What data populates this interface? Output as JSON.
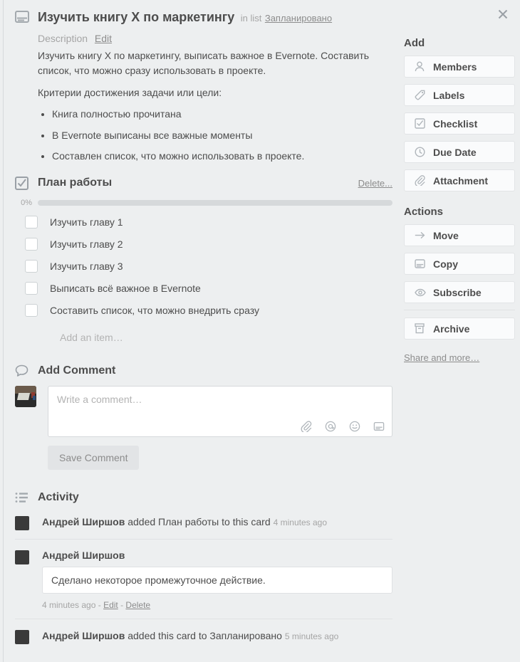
{
  "header": {
    "card_icon": "card-window-icon",
    "title": "Изучить книгу X по маркетингу",
    "in_list_label": "in list",
    "list_name": "Запланировано",
    "close_icon": "close-icon"
  },
  "description": {
    "heading": "Description",
    "edit_label": "Edit",
    "paragraph": "Изучить книгу X по маркетингу, выписать важное в Evernote. Составить список, что можно сразу использовать в проекте.",
    "criteria_intro": "Критерии достижения задачи или цели:",
    "criteria": [
      "Книга полностью прочитана",
      "В Evernote выписаны все важные моменты",
      "Составлен список, что можно использовать в проекте."
    ]
  },
  "checklist": {
    "icon": "checklist-icon",
    "title": "План работы",
    "delete_label": "Delete...",
    "progress_percent": "0%",
    "progress_value": 0,
    "items": [
      {
        "label": "Изучить главу 1",
        "checked": false
      },
      {
        "label": "Изучить главу 2",
        "checked": false
      },
      {
        "label": "Изучить главу 3",
        "checked": false
      },
      {
        "label": "Выписать всё важное в Evernote",
        "checked": false
      },
      {
        "label": "Составить список, что можно внедрить сразу",
        "checked": false
      }
    ],
    "add_item_placeholder": "Add an item…"
  },
  "comment": {
    "icon": "comment-bubble-icon",
    "heading": "Add Comment",
    "placeholder": "Write a comment…",
    "value": "",
    "tools": [
      "attachment-icon",
      "mention-icon",
      "emoji-icon",
      "card-icon"
    ],
    "save_label": "Save Comment"
  },
  "activity": {
    "icon": "activity-list-icon",
    "heading": "Activity",
    "entries": [
      {
        "type": "action",
        "author": "Андрей Ширшов",
        "action_text": "added План работы to this card",
        "time": "4 minutes ago"
      },
      {
        "type": "comment",
        "author": "Андрей Ширшов",
        "text": "Сделано некоторое промежуточное действие.",
        "time": "4 minutes ago",
        "edit_label": "Edit",
        "delete_label": "Delete",
        "separator": "-"
      },
      {
        "type": "action",
        "author": "Андрей Ширшов",
        "action_text": "added this card to Запланировано",
        "time": "5 minutes ago"
      }
    ]
  },
  "sidebar": {
    "add_title": "Add",
    "add_buttons": [
      {
        "label": "Members",
        "icon": "member-icon"
      },
      {
        "label": "Labels",
        "icon": "label-tag-icon"
      },
      {
        "label": "Checklist",
        "icon": "checklist-icon"
      },
      {
        "label": "Due Date",
        "icon": "clock-icon"
      },
      {
        "label": "Attachment",
        "icon": "paperclip-icon"
      }
    ],
    "actions_title": "Actions",
    "action_buttons": [
      {
        "label": "Move",
        "icon": "arrow-right-icon"
      },
      {
        "label": "Copy",
        "icon": "copy-card-icon"
      },
      {
        "label": "Subscribe",
        "icon": "eye-icon"
      }
    ],
    "archive_button": {
      "label": "Archive",
      "icon": "archive-box-icon"
    },
    "share_link": "Share and more…"
  },
  "colors": {
    "background": "#edeff0",
    "text": "#4d4d4d",
    "muted": "#a5a5a5",
    "progress_fill": "#61bd4f",
    "button_bg": "#fafbfc"
  }
}
